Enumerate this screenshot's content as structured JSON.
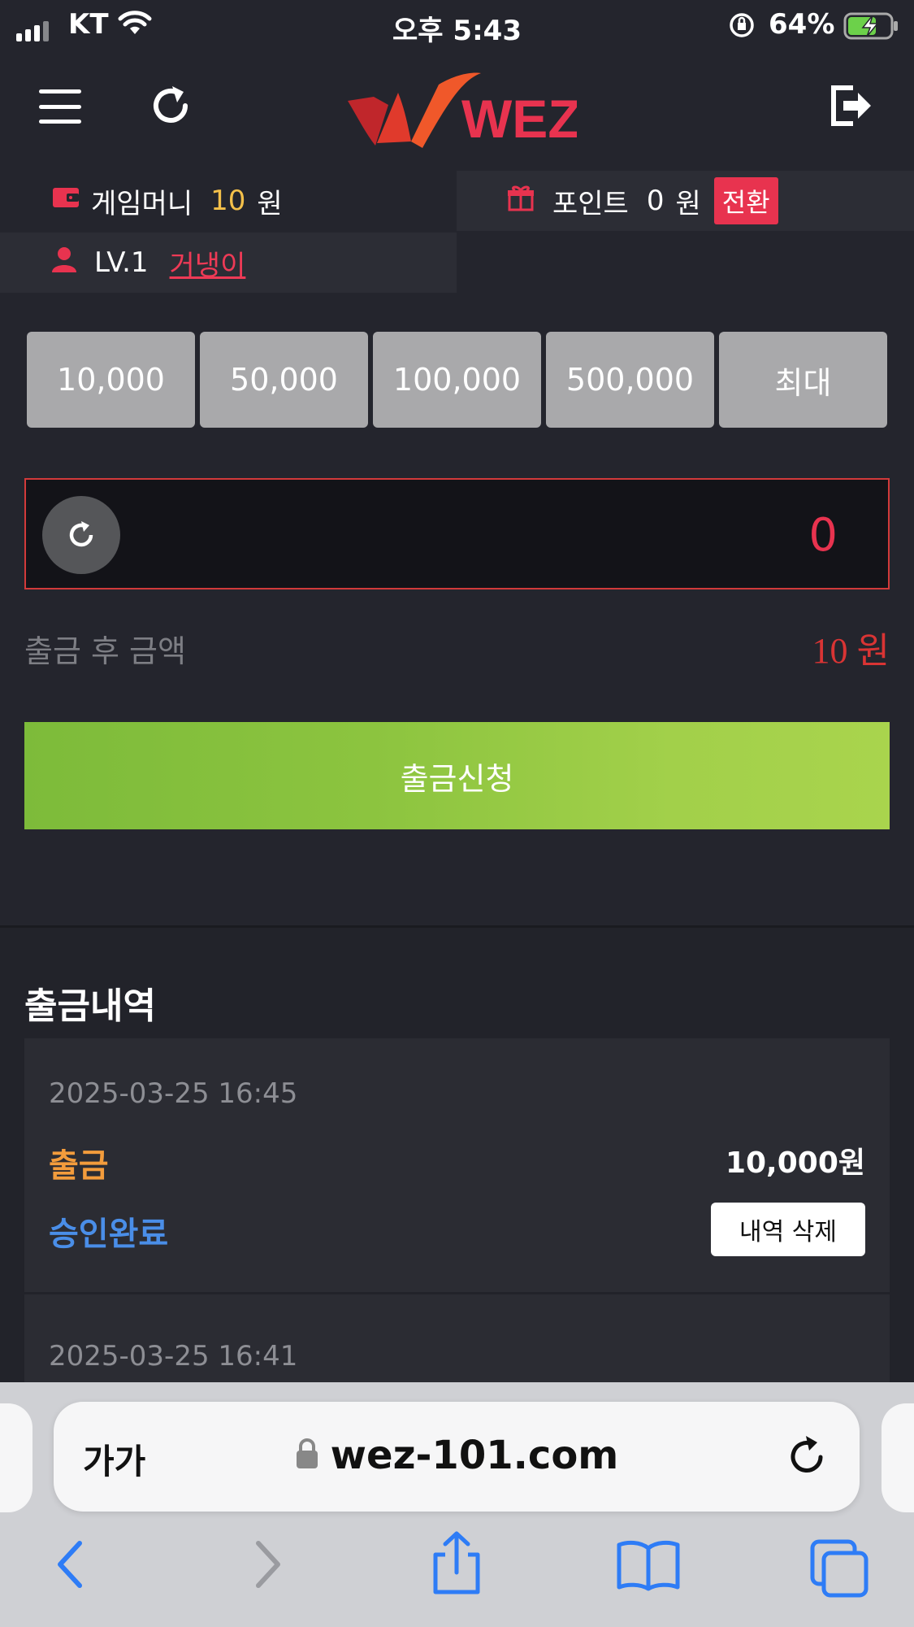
{
  "status_bar": {
    "carrier": "KT",
    "time": "오후 5:43",
    "battery_percent": "64%"
  },
  "header": {
    "logo_text": "WEZ"
  },
  "wallet": {
    "money_label": "게임머니",
    "money_value": "10",
    "money_unit": "원",
    "point_label": "포인트",
    "point_value": "0",
    "point_unit": "원",
    "convert_label": "전환",
    "level": "LV.1",
    "nickname": "거냉이"
  },
  "amount_buttons": [
    "10,000",
    "50,000",
    "100,000",
    "500,000",
    "최대"
  ],
  "withdraw_form": {
    "amount_value": "0",
    "after_label": "출금 후 금액",
    "after_value": "10 원",
    "submit_label": "출금신청"
  },
  "history": {
    "title": "출금내역",
    "items": [
      {
        "date": "2025-03-25 16:45",
        "type": "출금",
        "amount": "10,000원",
        "status": "승인완료",
        "delete_label": "내역 삭제"
      },
      {
        "date": "2025-03-25 16:41"
      }
    ]
  },
  "browser": {
    "text_size_label": "가가",
    "url": "wez-101.com"
  },
  "colors": {
    "background": "#24252d",
    "accent_red": "#e8334f",
    "gold": "#f4c04a",
    "green_button": "#8cc43f",
    "status_blue": "#4a8ee8",
    "type_orange": "#f39c3c"
  },
  "icons": [
    "menu-icon",
    "refresh-icon",
    "logout-icon",
    "wallet-icon",
    "gift-icon",
    "user-icon",
    "reset-icon",
    "lock-icon",
    "back-icon",
    "forward-icon",
    "share-icon",
    "bookmarks-icon",
    "tabs-icon"
  ]
}
